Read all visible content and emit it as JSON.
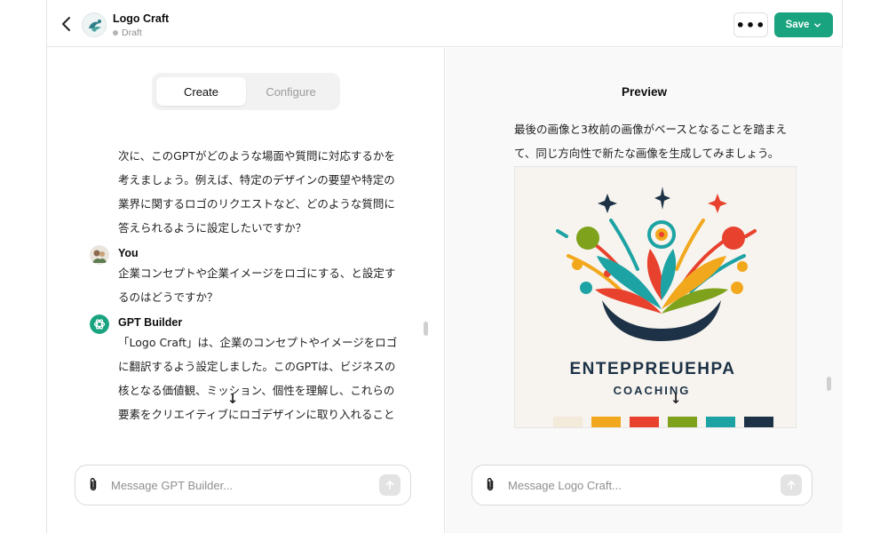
{
  "header": {
    "title": "Logo Craft",
    "status": "Draft",
    "more_label": "•••",
    "save_label": "Save"
  },
  "left": {
    "tabs": [
      {
        "label": "Create",
        "active": true
      },
      {
        "label": "Configure",
        "active": false
      }
    ],
    "intro_message": "次に、このGPTがどのような場面や質問に対応するかを考えましょう。例えば、特定のデザインの要望や特定の業界に関するロゴのリクエストなど、どのような質問に答えられるように設定したいですか？",
    "user_name": "You",
    "user_message": "企業コンセプトや企業イメージをロゴにする、と設定するのはどうですか？",
    "builder_name": "GPT Builder",
    "builder_message": "「Logo Craft」は、企業のコンセプトやイメージをロゴに翻訳するよう設定しました。このGPTは、ビジネスの核となる価値観、ミッション、個性を理解し、これらの要素をクリエイティブにロゴデザインに取り入れることに特化しています。ビジネスのブランドアイデンティティの本質を捉え、それをロ",
    "composer_placeholder": "Message GPT Builder..."
  },
  "right": {
    "title": "Preview",
    "message": "最後の画像と3枚前の画像がベースとなることを踏まえて、同じ方向性で新たな画像を生成してみましょう。",
    "image_heading": "ENTEPPREUEHPA",
    "image_subheading": "COACHING",
    "palette": [
      "#f3ead9",
      "#f2a81d",
      "#e8412e",
      "#7ea21b",
      "#1ea3a4",
      "#1d3246"
    ],
    "composer_placeholder": "Message Logo Craft..."
  },
  "colors": {
    "accent": "#19a37f"
  }
}
